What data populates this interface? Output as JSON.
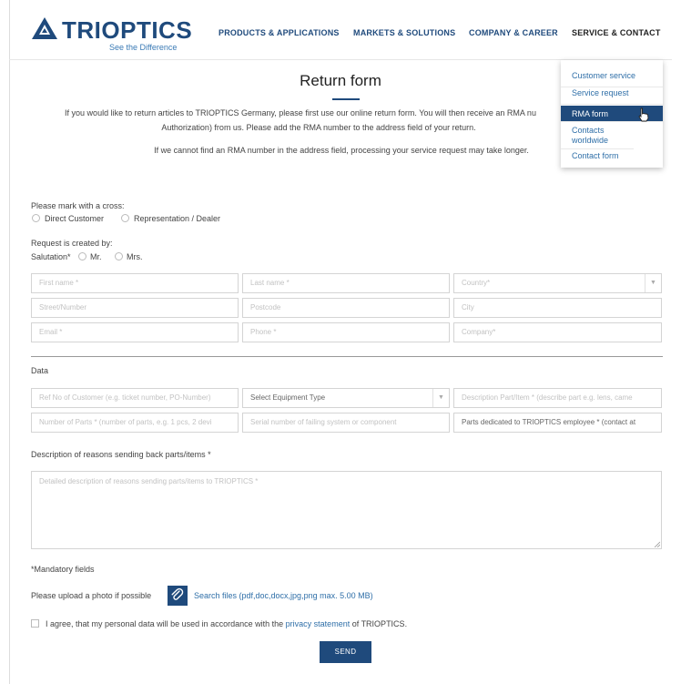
{
  "brand": {
    "name": "TRIOPTICS",
    "tagline": "See the Difference",
    "color": "#1f4a7c",
    "accent": "#2f6fa8"
  },
  "nav": {
    "items": [
      "PRODUCTS & APPLICATIONS",
      "MARKETS & SOLUTIONS",
      "COMPANY & CAREER",
      "SERVICE & CONTACT"
    ],
    "active": "SERVICE & CONTACT",
    "dropdown": [
      "Customer service",
      "Service request",
      "RMA form",
      "Contacts worldwide",
      "Contact form"
    ],
    "dropdown_active": "RMA form"
  },
  "page": {
    "title": "Return form",
    "intro_line1": "If you would like to return articles to TRIOPTICS Germany, please first use our online return form. You will then receive an RMA nu",
    "intro_line2": "Authorization) from us. Please add the RMA number to the address field of your return.",
    "intro_line3": "If we cannot find an RMA number in the address field, processing your service request may take longer."
  },
  "form": {
    "mark_label": "Please mark with a cross:",
    "customer_options": [
      "Direct Customer",
      "Representation / Dealer"
    ],
    "created_by_label": "Request is created by:",
    "salutation_label": "Salutation*",
    "salutation_options": [
      "Mr.",
      "Mrs."
    ],
    "contact_fields": {
      "first_name": "First name *",
      "last_name": "Last name *",
      "country": "Country*",
      "street": "Street/Number",
      "postcode": "Postcode",
      "city": "City",
      "email": "Email *",
      "phone": "Phone *",
      "company": "Company*"
    },
    "data_label": "Data",
    "data_fields": {
      "ref_no": "Ref No of Customer (e.g. ticket number, PO-Number)",
      "equipment_type": "Select Equipment Type",
      "description_part": "Description Part/Item * (describe part e.g. lens, came",
      "number_of_parts": "Number of Parts * (number of parts, e.g. 1 pcs, 2 devi",
      "serial_number": "Serial number of failing system or component",
      "parts_dedicated": "Parts dedicated to TRIOPTICS employee * (contact at"
    },
    "reasons_label": "Description of reasons sending back parts/items *",
    "reasons_placeholder": "Detailed description of reasons sending parts/items to TRIOPTICS *",
    "mandatory_note": "*Mandatory fields",
    "upload_label": "Please upload a photo if possible",
    "upload_link": "Search files (pdf,doc,docx,jpg,png max. 5.00 MB)",
    "consent_prefix": "I agree, that my personal data will be used in accordance with the",
    "consent_link": "privacy statement",
    "consent_suffix": "of TRIOPTICS.",
    "send_label": "SEND"
  }
}
